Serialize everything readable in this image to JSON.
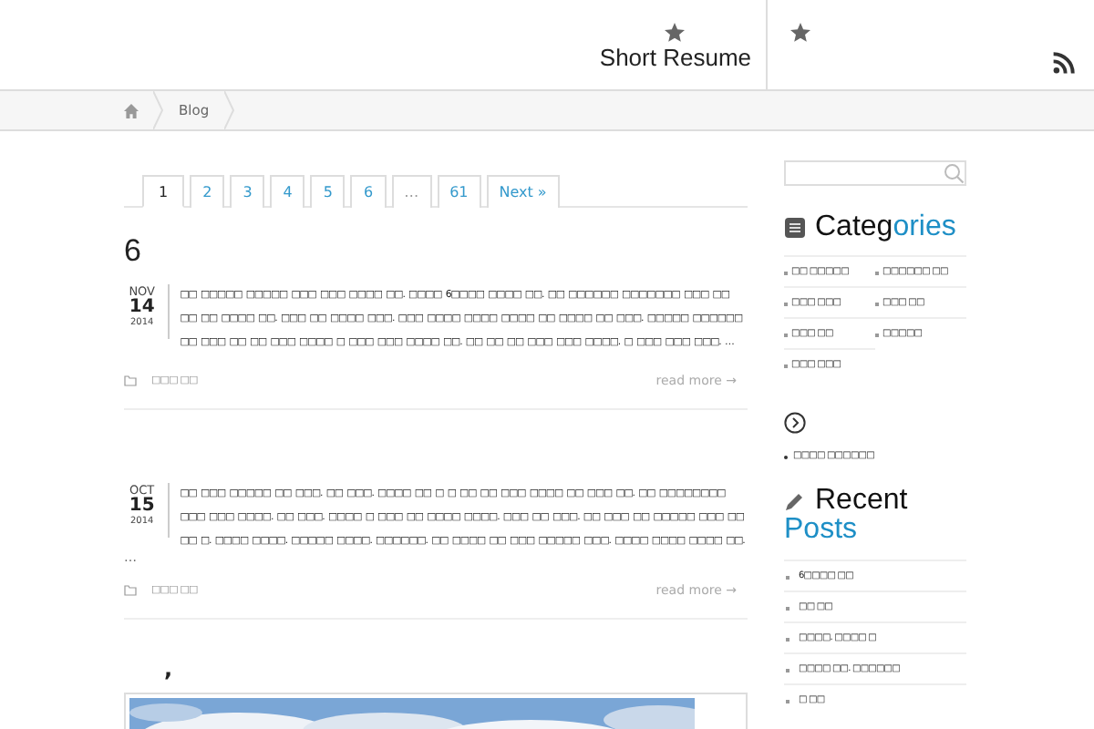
{
  "header": {
    "menu": [
      {
        "kind": "labelled",
        "label": "Short Resume"
      },
      {
        "kind": "icon_only"
      }
    ]
  },
  "breadcrumb": [
    "Blog"
  ],
  "pagination": [
    {
      "label": "1",
      "selected": true
    },
    {
      "label": "2",
      "selected": false
    },
    {
      "label": "3",
      "selected": false
    },
    {
      "label": "4",
      "selected": false
    },
    {
      "label": "5",
      "selected": false
    },
    {
      "label": "6",
      "selected": false
    },
    {
      "label": "…",
      "selected": false
    },
    {
      "label": "61",
      "selected": false
    },
    {
      "label": "Next »",
      "selected": false
    }
  ],
  "posts": [
    {
      "title": "6",
      "month": "NOV",
      "day": "14",
      "year": "2014",
      "excerpt": "□□ □□□□□ □□□□□ □□□ □□□ □□□□ □□. □□□□ 6□□□□ □□□□ □□. □□ □□□□□□ □□□□□□□ □□□ □□ □□ □□ □□□□ □□. □□□ □□ □□□□ □□□. □□□ □□□□ □□□□ □□□□ □□ □□□□ □□ □□□. □□□□□ □□□□□□ □□ □□□ □□ □□ □□□ □□□□ □ □□□ □□□ □□□□ □□. □□ □□ □□ □□□ □□□ □□□□. □ □□□ □□□ □□□. …",
      "category": "□□□ □□",
      "more": "read more →"
    },
    {
      "month": "OCT",
      "day": "15",
      "year": "2014",
      "excerpt": "□□ □□□ □□□□□ □□ □□□. □□ □□□. □□□□ □□ □ □ □□ □□ □□□ □□□□ □□ □□□ □□. □□ □□□□□□□□ □□□ □□□ □□□□. □□ □□□. □□□□ □ □□□ □□ □□□□ □□□□. □□□ □□ □□□. □□ □□□ □□ □□□□□ □□□ □□ □□ □. □□□□ □□□□. □□□□□ □□□□. □□□□□□. □□ □□□□ □□ □□□ □□□□□ □□□. □□□□ □□□□ □□□□ □□.",
      "tail": "…",
      "category": "□□□ □□",
      "more": "read more →"
    }
  ],
  "next_post": {
    "title": ","
  },
  "sidebar": {
    "categories": {
      "title": "Categ",
      "title_accent": "ories",
      "items": [
        "□□ □□□□□",
        "□□□□□□ □□",
        "□□□ □□□",
        "□□□ □□",
        "□□□ □□",
        "□□□□□",
        "□□□ □□□"
      ]
    },
    "links": {
      "items": [
        "□□□□ □□□□□□"
      ]
    },
    "recent": {
      "title": "Recent",
      "title_accent": "Posts",
      "items": [
        "6□□□□ □□",
        "□□ □□",
        "□□□□. □□□□ □",
        "□□□□ □□. □□□□□□",
        "□ □□"
      ]
    }
  }
}
